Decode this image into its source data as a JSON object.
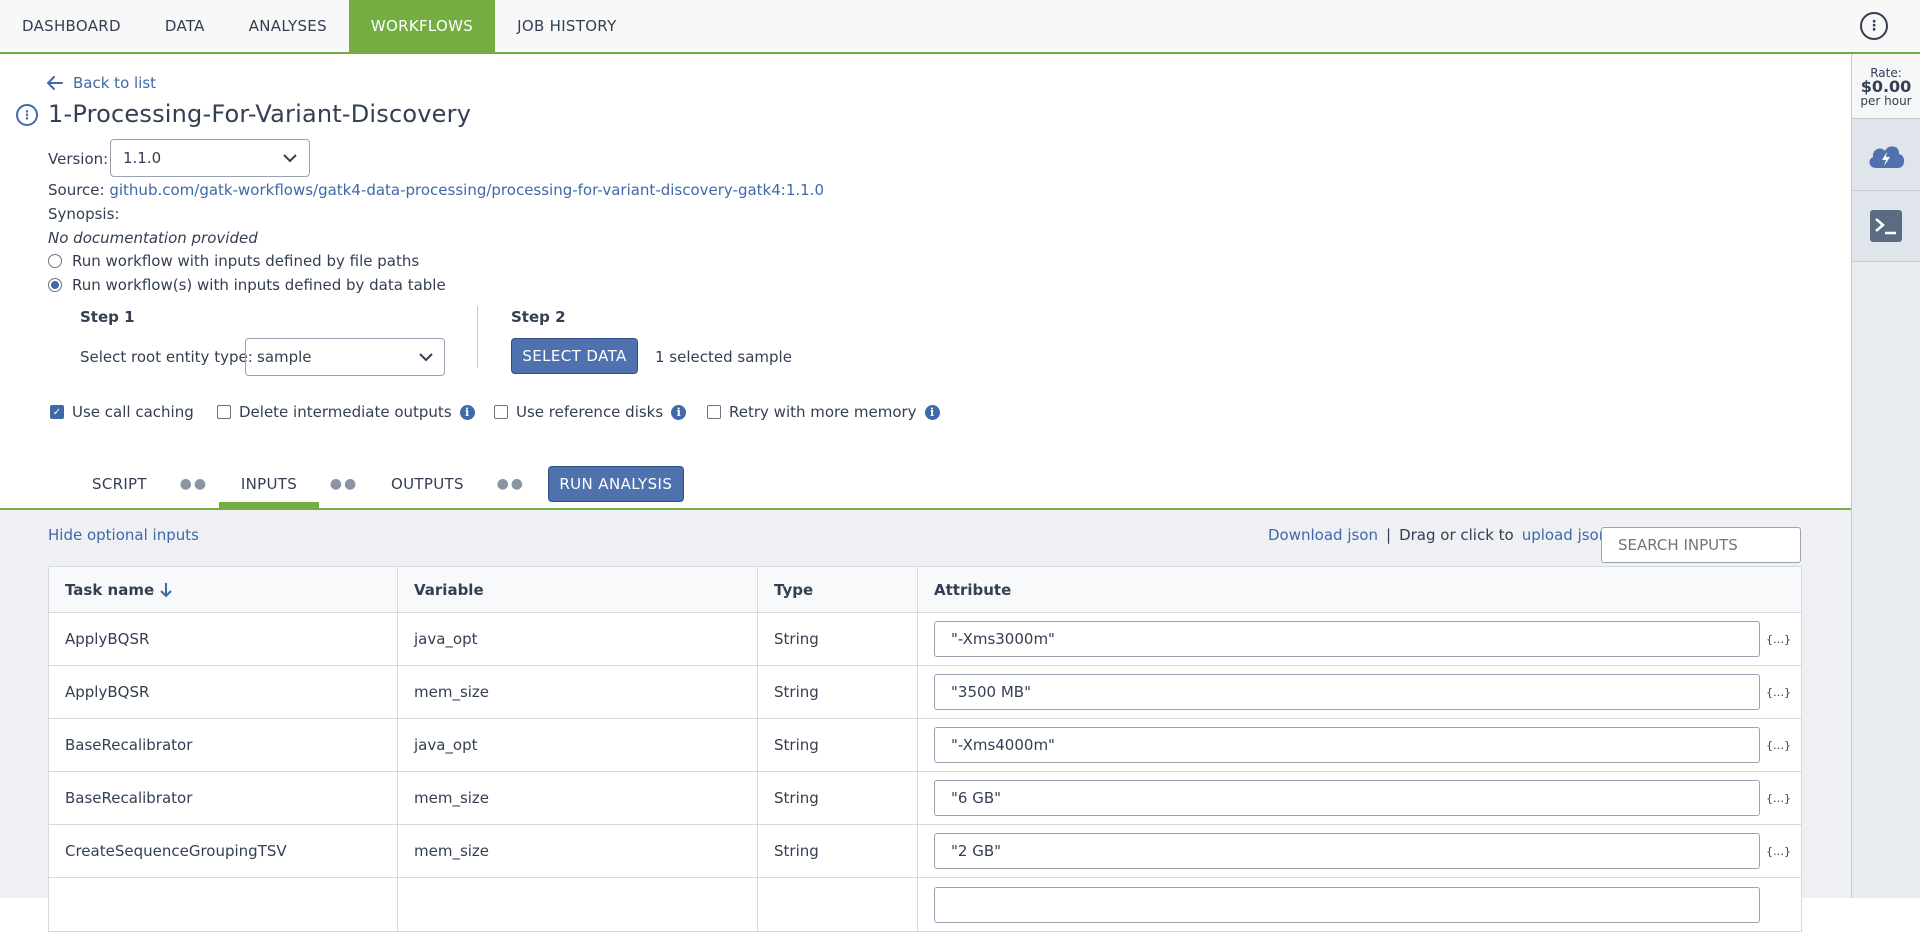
{
  "topnav": {
    "tabs": [
      {
        "label": "DASHBOARD"
      },
      {
        "label": "DATA"
      },
      {
        "label": "ANALYSES"
      },
      {
        "label": "WORKFLOWS",
        "active": true
      },
      {
        "label": "JOB HISTORY"
      }
    ],
    "more_icon": "vertical-ellipsis-icon"
  },
  "sidebar": {
    "rate_label": "Rate:",
    "rate_amount": "$0.00",
    "rate_unit": "per hour",
    "buttons": [
      {
        "icon": "cloud-lightning-icon"
      },
      {
        "icon": "terminal-icon"
      }
    ]
  },
  "workflow": {
    "back_label": "Back to list",
    "title": "1-Processing-For-Variant-Discovery",
    "version_label": "Version:",
    "version_value": "1.1.0",
    "source_label": "Source:",
    "source_link": "github.com/gatk-workflows/gatk4-data-processing/processing-for-variant-discovery-gatk4:1.1.0",
    "synopsis_label": "Synopsis:",
    "doc_text": "No documentation provided",
    "radio_file_paths": "Run workflow with inputs defined by file paths",
    "radio_data_table": "Run workflow(s) with inputs defined by data table",
    "selected_radio": "data_table"
  },
  "steps": {
    "step1_title": "Step 1",
    "root_label": "Select root entity type:",
    "root_value": "sample",
    "step2_title": "Step 2",
    "select_button": "SELECT DATA",
    "selected_text": "1 selected sample"
  },
  "options": [
    {
      "label": "Use call caching",
      "checked": true,
      "info": false
    },
    {
      "label": "Delete intermediate outputs",
      "checked": false,
      "info": true
    },
    {
      "label": "Use reference disks",
      "checked": false,
      "info": true
    },
    {
      "label": "Retry with more memory",
      "checked": false,
      "info": true
    }
  ],
  "subtabs": {
    "script": "SCRIPT",
    "inputs": "INPUTS",
    "outputs": "OUTPUTS",
    "run_button": "RUN ANALYSIS",
    "active": "INPUTS"
  },
  "inputs_panel": {
    "hide_optional": "Hide optional inputs",
    "download_json": "Download json",
    "separator": "|",
    "drag_text": "Drag or click to",
    "upload_json": "upload json",
    "search_placeholder": "SEARCH INPUTS"
  },
  "table": {
    "headers": [
      "Task name",
      "Variable",
      "Type",
      "Attribute"
    ],
    "sort_icon": "arrow-down-icon",
    "expr_symbol": "{…}",
    "rows": [
      {
        "task": "ApplyBQSR",
        "variable": "java_opt",
        "type": "String",
        "attribute": "\"-Xms3000m\""
      },
      {
        "task": "ApplyBQSR",
        "variable": "mem_size",
        "type": "String",
        "attribute": "\"3500 MB\""
      },
      {
        "task": "BaseRecalibrator",
        "variable": "java_opt",
        "type": "String",
        "attribute": "\"-Xms4000m\""
      },
      {
        "task": "BaseRecalibrator",
        "variable": "mem_size",
        "type": "String",
        "attribute": "\"6 GB\""
      },
      {
        "task": "CreateSequenceGroupingTSV",
        "variable": "mem_size",
        "type": "String",
        "attribute": "\"2 GB\""
      }
    ]
  },
  "colors": {
    "accent_green": "#74ae43",
    "primary_blue": "#4f71ae",
    "link_blue": "#3f69a8",
    "text": "#333f52"
  }
}
